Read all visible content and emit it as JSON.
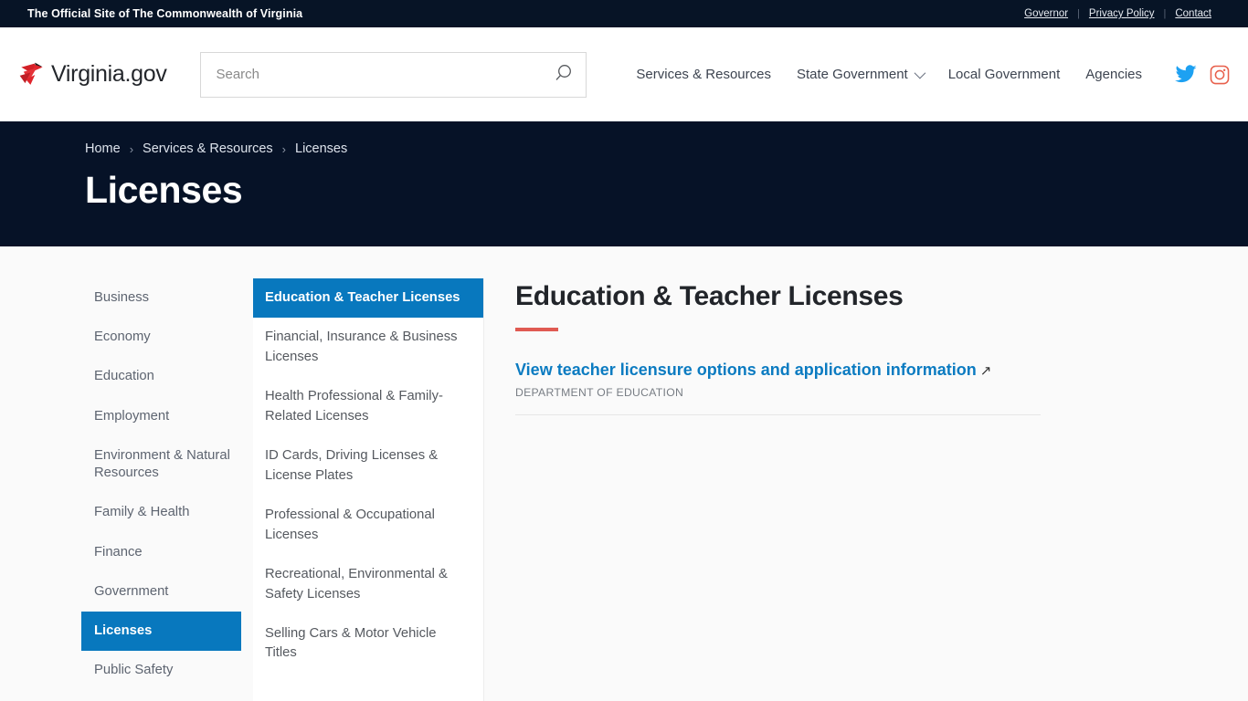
{
  "utility_bar": {
    "tagline": "The Official Site of The Commonwealth of Virginia",
    "links": [
      {
        "label": "Governor"
      },
      {
        "label": "Privacy Policy"
      },
      {
        "label": "Contact"
      }
    ],
    "separator": "|"
  },
  "header": {
    "logo_text": "Virginia.gov",
    "logo_icon": "cardinal-bird-icon",
    "search": {
      "placeholder": "Search",
      "value": "",
      "icon": "search-icon"
    },
    "nav": [
      {
        "label": "Services & Resources",
        "has_dropdown": false
      },
      {
        "label": "State Government",
        "has_dropdown": true
      },
      {
        "label": "Local Government",
        "has_dropdown": false
      },
      {
        "label": "Agencies",
        "has_dropdown": false
      }
    ],
    "social": [
      {
        "name": "twitter-icon",
        "color": "#1da1f2"
      },
      {
        "name": "instagram-icon",
        "color": "#e8604c"
      }
    ]
  },
  "hero": {
    "breadcrumb": [
      {
        "label": "Home"
      },
      {
        "label": "Services & Resources"
      },
      {
        "label": "Licenses"
      }
    ],
    "breadcrumb_separator": "›",
    "title": "Licenses",
    "background_color": "#061227"
  },
  "sidebar": {
    "items": [
      {
        "label": "Business",
        "active": false
      },
      {
        "label": "Economy",
        "active": false
      },
      {
        "label": "Education",
        "active": false
      },
      {
        "label": "Employment",
        "active": false
      },
      {
        "label": "Environment & Natural Resources",
        "active": false
      },
      {
        "label": "Family & Health",
        "active": false
      },
      {
        "label": "Finance",
        "active": false
      },
      {
        "label": "Government",
        "active": false
      },
      {
        "label": "Licenses",
        "active": true
      },
      {
        "label": "Public Safety",
        "active": false
      }
    ],
    "active_color": "#0878be"
  },
  "submenu": {
    "items": [
      {
        "label": "Education & Teacher Licenses",
        "active": true
      },
      {
        "label": "Financial, Insurance & Business Licenses",
        "active": false
      },
      {
        "label": "Health Professional & Family-Related Licenses",
        "active": false
      },
      {
        "label": "ID Cards, Driving Licenses & License Plates",
        "active": false
      },
      {
        "label": "Professional & Occupational Licenses",
        "active": false
      },
      {
        "label": "Recreational, Environmental & Safety Licenses",
        "active": false
      },
      {
        "label": "Selling Cars & Motor Vehicle Titles",
        "active": false
      }
    ]
  },
  "main": {
    "title": "Education & Teacher Licenses",
    "rule_color": "#e05a52",
    "results": [
      {
        "link_text": "View teacher licensure options and application information",
        "external_icon": "↗",
        "agency": "DEPARTMENT OF EDUCATION"
      }
    ]
  }
}
